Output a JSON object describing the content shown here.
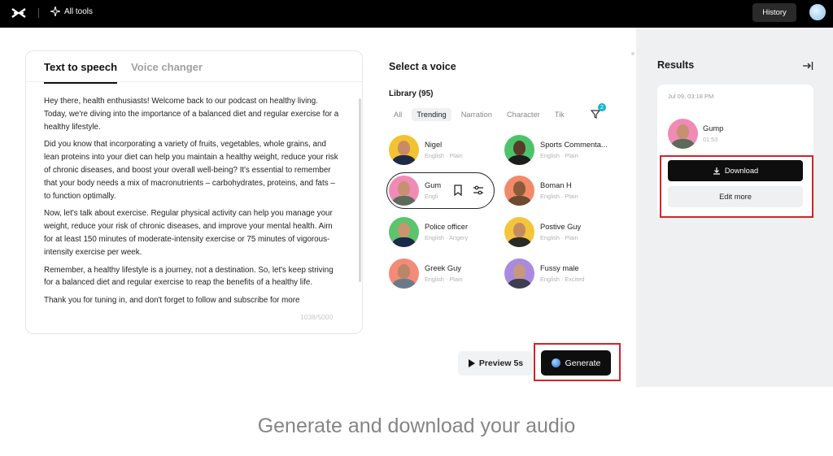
{
  "topbar": {
    "all_tools": "All tools",
    "history": "History"
  },
  "text_panel": {
    "tabs": [
      "Text to speech",
      "Voice changer"
    ],
    "paragraphs": [
      "Hey there, health enthusiasts! Welcome back to our podcast on healthy living. Today, we're diving into the importance of a balanced diet and regular exercise for a healthy lifestyle.",
      "Did you know that incorporating a variety of fruits, vegetables, whole grains, and lean proteins into your diet can help you maintain a healthy weight, reduce your risk of chronic diseases, and boost your overall well-being? It's essential to remember that your body needs a mix of macronutrients – carbohydrates, proteins, and fats – to function optimally.",
      "Now, let's talk about exercise. Regular physical activity can help you manage your weight, reduce your risk of chronic diseases, and improve your mental health. Aim for at least 150 minutes of moderate-intensity exercise or 75 minutes of vigorous-intensity exercise per week.",
      "Remember, a healthy lifestyle is a journey, not a destination. So, let's keep striving for a balanced diet and regular exercise to reap the benefits of a healthy life.",
      "Thank you for tuning in, and don't forget to follow and subscribe for more"
    ],
    "char_count": "1038/5000"
  },
  "voice_panel": {
    "title": "Select a voice",
    "library": "Library (95)",
    "filters": [
      "All",
      "Trending",
      "Narration",
      "Character",
      "Tik"
    ],
    "filter_badge": "2",
    "voices": [
      {
        "name": "Nigel",
        "meta": "English · Plain"
      },
      {
        "name": "Sports Commenta...",
        "meta": "English · Plain"
      },
      {
        "name": "Gum",
        "meta": "Engli"
      },
      {
        "name": "Boman H",
        "meta": "English · Plain"
      },
      {
        "name": "Police officer",
        "meta": "English · Angery"
      },
      {
        "name": "Postive Guy",
        "meta": "English · Plain"
      },
      {
        "name": "Greek Guy",
        "meta": "English · Plain"
      },
      {
        "name": "Fussy male",
        "meta": "English · Excited"
      }
    ]
  },
  "actions": {
    "preview": "Preview 5s",
    "generate": "Generate"
  },
  "results": {
    "title": "Results",
    "date": "Jul 09, 03:18 PM",
    "name": "Gump",
    "duration": "01:53",
    "download": "Download",
    "edit_more": "Edit more"
  },
  "caption": "Generate and download your audio",
  "colors": {
    "highlight": "#d2232a",
    "accent": "#16b7c9"
  }
}
